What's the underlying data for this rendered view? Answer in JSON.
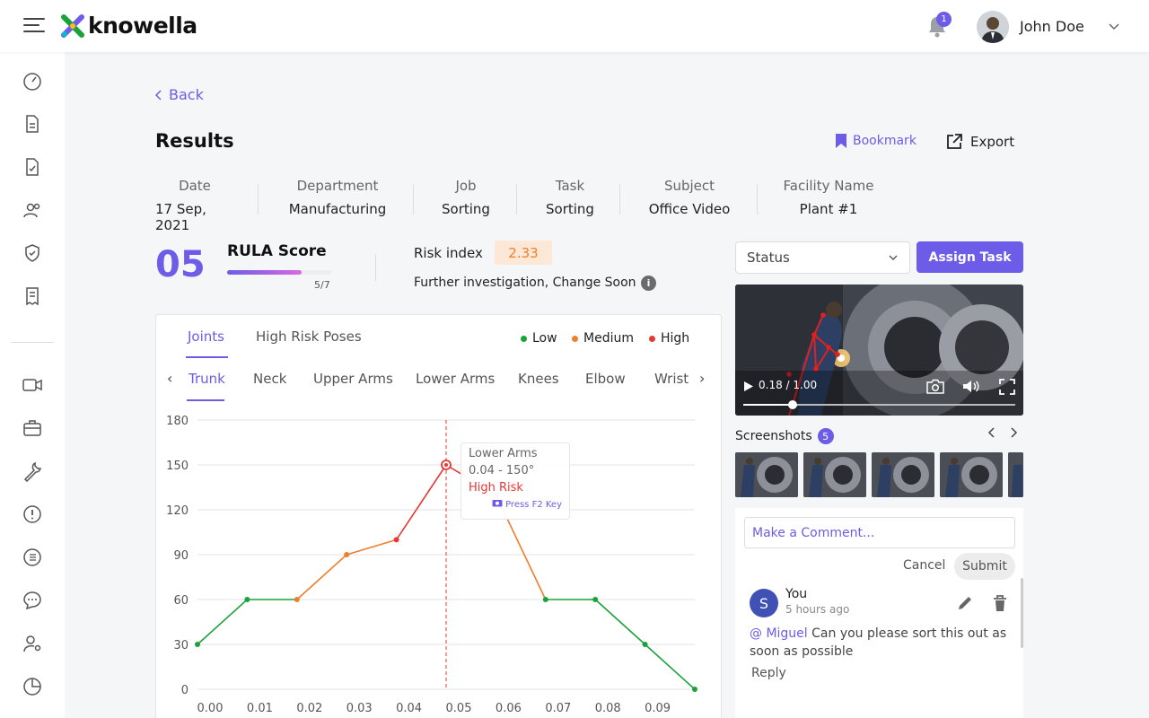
{
  "app": {
    "logo_text": "knowella"
  },
  "header": {
    "notification_count": "1",
    "user_name": "John Doe"
  },
  "page": {
    "back_label": "Back",
    "title": "Results",
    "bookmark_label": "Bookmark",
    "export_label": "Export"
  },
  "meta": [
    {
      "label": "Date",
      "value": "17 Sep, 2021"
    },
    {
      "label": "Department",
      "value": "Manufacturing"
    },
    {
      "label": "Job",
      "value": "Sorting"
    },
    {
      "label": "Task",
      "value": "Sorting"
    },
    {
      "label": "Subject",
      "value": "Office Video"
    },
    {
      "label": "Facility Name",
      "value": "Plant #1"
    }
  ],
  "score": {
    "value": "05",
    "title": "RULA Score",
    "fraction": "5/7",
    "progress": 0.714,
    "risk_label": "Risk index",
    "risk_value": "2.33",
    "note": "Further investigation, Change Soon",
    "info_glyph": "i"
  },
  "tabs": {
    "main": [
      "Joints",
      "High Risk Poses"
    ],
    "active_main": 0,
    "joints": [
      "Trunk",
      "Neck",
      "Upper Arms",
      "Lower Arms",
      "Knees",
      "Elbow",
      "Wrist"
    ],
    "active_joint": 0
  },
  "legend": [
    {
      "label": "Low",
      "color": "#1aa33a"
    },
    {
      "label": "Medium",
      "color": "#f07d2a"
    },
    {
      "label": "High",
      "color": "#e53935"
    }
  ],
  "tooltip": {
    "title": "Lower Arms",
    "value": "0.04 - 150°",
    "risk": "High Risk",
    "hint": "Press F2 Key"
  },
  "chart_data": {
    "type": "line",
    "x": [
      0.0,
      0.01,
      0.02,
      0.03,
      0.04,
      0.05,
      0.06,
      0.07,
      0.08,
      0.09,
      0.1
    ],
    "y": [
      30,
      60,
      60,
      90,
      100,
      150,
      130,
      60,
      60,
      30,
      0
    ],
    "x_tick_labels": [
      "0.00",
      "0.01",
      "0.02",
      "0.03",
      "0.04",
      "0.05",
      "0.06",
      "0.07",
      "0.08",
      "0.09"
    ],
    "y_ticks": [
      0,
      30,
      60,
      90,
      120,
      150,
      180
    ],
    "ylim": [
      0,
      180
    ],
    "xlim": [
      0.0,
      0.1
    ],
    "highlight_x": 0.05,
    "grid": true,
    "segment_levels": [
      "Low",
      "Low",
      "Medium",
      "Medium",
      "High",
      "High",
      "Medium",
      "Low",
      "Low",
      "Low"
    ],
    "colors": {
      "Low": "#1aa33a",
      "Medium": "#f07d2a",
      "High": "#e53935"
    }
  },
  "right": {
    "status_label": "Status",
    "assign_label": "Assign Task",
    "video_time": "0.18 / 1.00",
    "video_progress": 0.18,
    "screenshots_label": "Screenshots",
    "screenshots_count": "5"
  },
  "comment": {
    "placeholder": "Make a Comment...",
    "cancel_label": "Cancel",
    "submit_label": "Submit",
    "author_initial": "S",
    "author": "You",
    "time": "5 hours ago",
    "mention": "@ Miguel",
    "text": " Can you please sort this out as soon as possible",
    "reply_label": "Reply"
  }
}
